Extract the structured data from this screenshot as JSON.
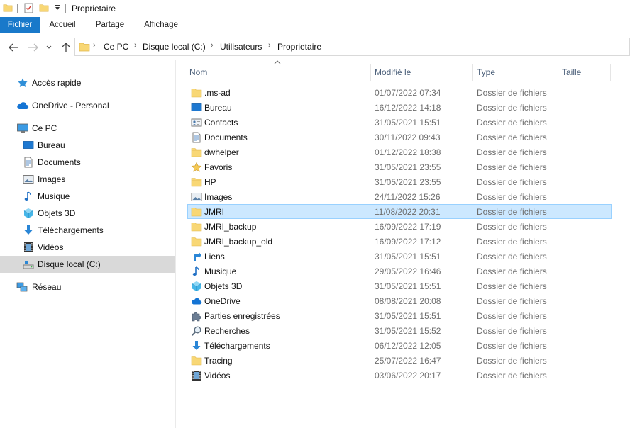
{
  "window": {
    "title": "Proprietaire"
  },
  "ribbon": {
    "tabs": [
      "Fichier",
      "Accueil",
      "Partage",
      "Affichage"
    ]
  },
  "address": {
    "crumbs": [
      "Ce PC",
      "Disque local (C:)",
      "Utilisateurs",
      "Proprietaire"
    ]
  },
  "nav": {
    "items": [
      {
        "label": "Accès rapide",
        "icon": "star-icon"
      },
      {
        "label": "OneDrive - Personal",
        "icon": "cloud-icon"
      },
      {
        "label": "Ce PC",
        "icon": "computer-icon"
      },
      {
        "label": "Bureau",
        "icon": "desktop-icon"
      },
      {
        "label": "Documents",
        "icon": "document-icon"
      },
      {
        "label": "Images",
        "icon": "picture-icon"
      },
      {
        "label": "Musique",
        "icon": "music-icon"
      },
      {
        "label": "Objets 3D",
        "icon": "cube-icon"
      },
      {
        "label": "Téléchargements",
        "icon": "download-icon"
      },
      {
        "label": "Vidéos",
        "icon": "film-icon"
      },
      {
        "label": "Disque local (C:)",
        "icon": "drive-icon",
        "selected": true
      },
      {
        "label": "Réseau",
        "icon": "network-icon"
      }
    ]
  },
  "columns": {
    "name": "Nom",
    "modified": "Modifié le",
    "type": "Type",
    "size": "Taille"
  },
  "files": [
    {
      "name": ".ms-ad",
      "date": "01/07/2022 07:34",
      "type": "Dossier de fichiers",
      "icon": "folder-icon"
    },
    {
      "name": "Bureau",
      "date": "16/12/2022 14:18",
      "type": "Dossier de fichiers",
      "icon": "desktop-icon"
    },
    {
      "name": "Contacts",
      "date": "31/05/2021 15:51",
      "type": "Dossier de fichiers",
      "icon": "contacts-icon"
    },
    {
      "name": "Documents",
      "date": "30/11/2022 09:43",
      "type": "Dossier de fichiers",
      "icon": "document-icon"
    },
    {
      "name": "dwhelper",
      "date": "01/12/2022 18:38",
      "type": "Dossier de fichiers",
      "icon": "folder-icon"
    },
    {
      "name": "Favoris",
      "date": "31/05/2021 23:55",
      "type": "Dossier de fichiers",
      "icon": "star-icon"
    },
    {
      "name": "HP",
      "date": "31/05/2021 23:55",
      "type": "Dossier de fichiers",
      "icon": "folder-icon"
    },
    {
      "name": "Images",
      "date": "24/11/2022 15:26",
      "type": "Dossier de fichiers",
      "icon": "picture-icon"
    },
    {
      "name": "JMRI",
      "date": "11/08/2022 20:31",
      "type": "Dossier de fichiers",
      "icon": "folder-icon",
      "selected": true
    },
    {
      "name": "JMRI_backup",
      "date": "16/09/2022 17:19",
      "type": "Dossier de fichiers",
      "icon": "folder-icon"
    },
    {
      "name": "JMRI_backup_old",
      "date": "16/09/2022 17:12",
      "type": "Dossier de fichiers",
      "icon": "folder-icon"
    },
    {
      "name": "Liens",
      "date": "31/05/2021 15:51",
      "type": "Dossier de fichiers",
      "icon": "link-icon"
    },
    {
      "name": "Musique",
      "date": "29/05/2022 16:46",
      "type": "Dossier de fichiers",
      "icon": "music-icon"
    },
    {
      "name": "Objets 3D",
      "date": "31/05/2021 15:51",
      "type": "Dossier de fichiers",
      "icon": "cube-icon"
    },
    {
      "name": "OneDrive",
      "date": "08/08/2021 20:08",
      "type": "Dossier de fichiers",
      "icon": "cloud-icon"
    },
    {
      "name": "Parties enregistrées",
      "date": "31/05/2021 15:51",
      "type": "Dossier de fichiers",
      "icon": "puzzle-icon"
    },
    {
      "name": "Recherches",
      "date": "31/05/2021 15:52",
      "type": "Dossier de fichiers",
      "icon": "search-icon"
    },
    {
      "name": "Téléchargements",
      "date": "06/12/2022 12:05",
      "type": "Dossier de fichiers",
      "icon": "download-icon"
    },
    {
      "name": "Tracing",
      "date": "25/07/2022 16:47",
      "type": "Dossier de fichiers",
      "icon": "folder-icon"
    },
    {
      "name": "Vidéos",
      "date": "03/06/2022 20:17",
      "type": "Dossier de fichiers",
      "icon": "film-icon"
    }
  ]
}
